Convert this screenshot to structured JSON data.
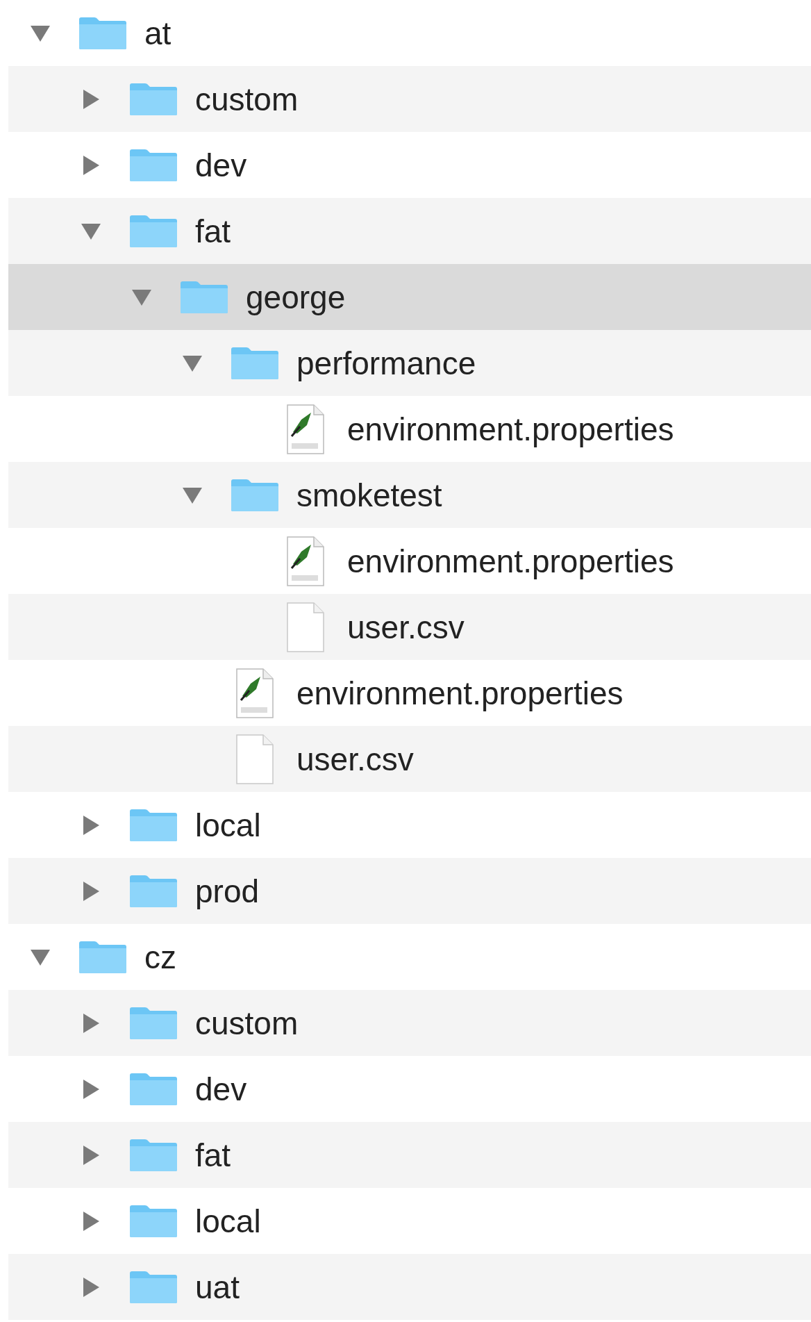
{
  "tree": [
    {
      "name": "at",
      "kind": "folder",
      "expanded": true,
      "selected": false,
      "children": [
        {
          "name": "custom",
          "kind": "folder",
          "expanded": false,
          "selected": false
        },
        {
          "name": "dev",
          "kind": "folder",
          "expanded": false,
          "selected": false
        },
        {
          "name": "fat",
          "kind": "folder",
          "expanded": true,
          "selected": false,
          "children": [
            {
              "name": "george",
              "kind": "folder",
              "expanded": true,
              "selected": true,
              "children": [
                {
                  "name": "performance",
                  "kind": "folder",
                  "expanded": true,
                  "selected": false,
                  "children": [
                    {
                      "name": "environment.properties",
                      "kind": "properties",
                      "selected": false
                    }
                  ]
                },
                {
                  "name": "smoketest",
                  "kind": "folder",
                  "expanded": true,
                  "selected": false,
                  "children": [
                    {
                      "name": "environment.properties",
                      "kind": "properties",
                      "selected": false
                    },
                    {
                      "name": "user.csv",
                      "kind": "file",
                      "selected": false
                    }
                  ]
                },
                {
                  "name": "environment.properties",
                  "kind": "properties",
                  "selected": false
                },
                {
                  "name": "user.csv",
                  "kind": "file",
                  "selected": false
                }
              ]
            }
          ]
        },
        {
          "name": "local",
          "kind": "folder",
          "expanded": false,
          "selected": false
        },
        {
          "name": "prod",
          "kind": "folder",
          "expanded": false,
          "selected": false
        }
      ]
    },
    {
      "name": "cz",
      "kind": "folder",
      "expanded": true,
      "selected": false,
      "children": [
        {
          "name": "custom",
          "kind": "folder",
          "expanded": false,
          "selected": false
        },
        {
          "name": "dev",
          "kind": "folder",
          "expanded": false,
          "selected": false
        },
        {
          "name": "fat",
          "kind": "folder",
          "expanded": false,
          "selected": false
        },
        {
          "name": "local",
          "kind": "folder",
          "expanded": false,
          "selected": false
        },
        {
          "name": "uat",
          "kind": "folder",
          "expanded": false,
          "selected": false
        }
      ]
    }
  ]
}
